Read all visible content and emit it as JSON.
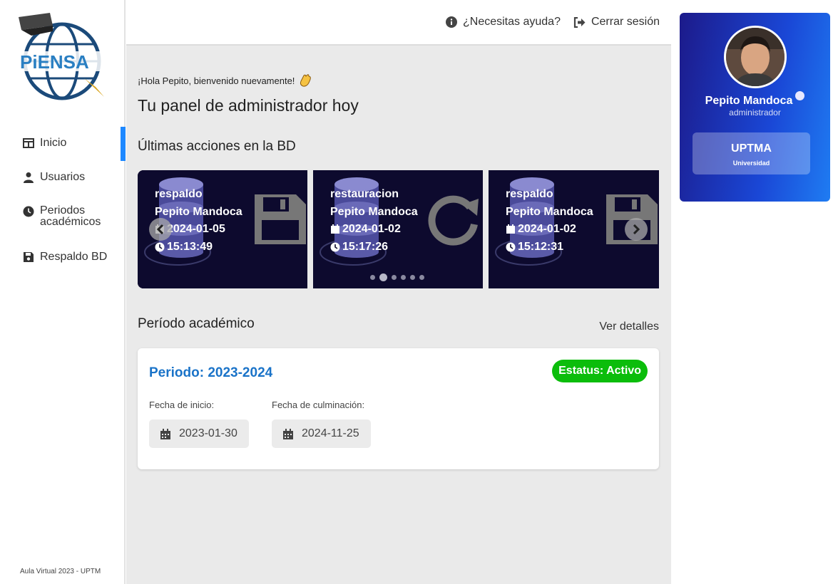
{
  "sidebar": {
    "logo_text": "PiENSA",
    "items": [
      {
        "label": "Inicio",
        "icon": "columns-icon",
        "active": true
      },
      {
        "label": "Usuarios",
        "icon": "user-icon",
        "active": false
      },
      {
        "label": "Periodos académicos",
        "icon": "clock-icon",
        "active": false
      },
      {
        "label": "Respaldo BD",
        "icon": "floppy-icon",
        "active": false
      }
    ],
    "footer": "Aula Virtual 2023 - UPTM"
  },
  "topbar": {
    "help": "¿Necesitas ayuda?",
    "logout": "Cerrar sesión"
  },
  "main": {
    "greeting": "¡Hola Pepito, bienvenido nuevamente!",
    "title": "Tu panel de administrador hoy",
    "actions_title": "Últimas acciones en la BD",
    "actions": [
      {
        "type": "respaldo",
        "user": "Pepito Mandoca",
        "date": "2024-01-05",
        "time": "15:13:49",
        "icon": "floppy-icon"
      },
      {
        "type": "restauracion",
        "user": "Pepito Mandoca",
        "date": "2024-01-02",
        "time": "15:17:26",
        "icon": "rotate-icon"
      },
      {
        "type": "respaldo",
        "user": "Pepito Mandoca",
        "date": "2024-01-02",
        "time": "15:12:31",
        "icon": "floppy-icon"
      }
    ],
    "carousel_dots": 6,
    "carousel_active_dot": 1,
    "period_title": "Período académico",
    "details_link": "Ver detalles",
    "period": {
      "name": "Periodo: 2023-2024",
      "status": "Estatus: Activo",
      "start_label": "Fecha de inicio:",
      "start": "2023-01-30",
      "end_label": "Fecha de culminación:",
      "end": "2024-11-25"
    }
  },
  "profile": {
    "name": "Pepito Mandoca",
    "role": "administrador",
    "university": "UPTMA",
    "university_sub": "Universidad"
  },
  "colors": {
    "accent": "#1e88ff",
    "period_title": "#1a73c8",
    "status": "#0bbd0b",
    "card_bg": "#0d0a2e"
  }
}
